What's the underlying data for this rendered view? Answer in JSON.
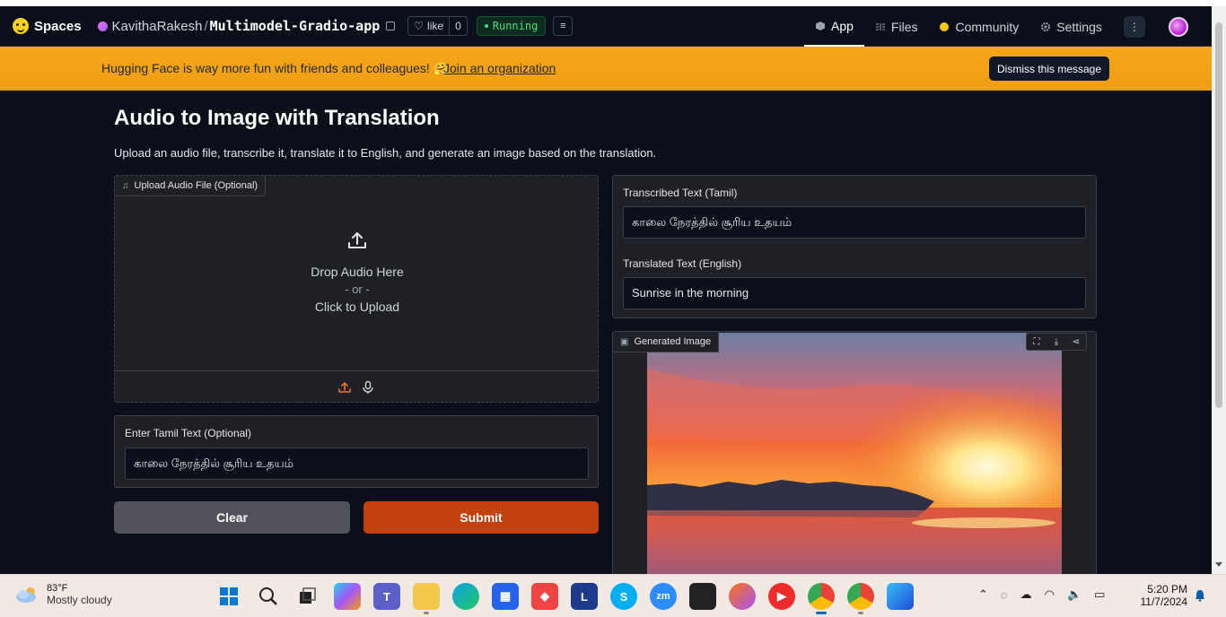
{
  "header": {
    "brand": "Spaces",
    "owner": "KavithaRakesh",
    "separator": "/",
    "repo": "Multimodel-Gradio-app",
    "like_label": "like",
    "like_count": "0",
    "status": "Running",
    "nav": [
      {
        "label": "App",
        "icon": "cube-icon",
        "active": true
      },
      {
        "label": "Files",
        "icon": "files-icon"
      },
      {
        "label": "Community",
        "icon": "community-icon"
      },
      {
        "label": "Settings",
        "icon": "gear-icon"
      }
    ]
  },
  "banner": {
    "text": "Hugging Face is way more fun with friends and colleagues! 🤗",
    "link": "Join an organization",
    "dismiss": "Dismiss this message"
  },
  "app": {
    "title": "Audio to Image with Translation",
    "description": "Upload an audio file, transcribe it, translate it to English, and generate an image based on the translation.",
    "upload": {
      "label": "Upload Audio File (Optional)",
      "drop": "Drop Audio Here",
      "or": "- or -",
      "click": "Click to Upload"
    },
    "tamil_input": {
      "label": "Enter Tamil Text (Optional)",
      "value": "காலை நேரத்தில் சூரிய உதயம்"
    },
    "clear": "Clear",
    "submit": "Submit",
    "transcribed": {
      "label": "Transcribed Text (Tamil)",
      "value": "காலை நேரத்தில் சூரிய உதயம்"
    },
    "translated": {
      "label": "Translated Text (English)",
      "value": "Sunrise in the morning"
    },
    "image_label": "Generated Image"
  },
  "taskbar": {
    "weather_temp": "83°F",
    "weather_desc": "Mostly cloudy",
    "time": "5:20 PM",
    "date": "11/7/2024",
    "apps": [
      "start",
      "search",
      "task-view",
      "copilot",
      "teams",
      "file-explorer",
      "edge",
      "store",
      "anydesk",
      "l-app",
      "skype",
      "zoom",
      "sticky-notes",
      "firefox",
      "youtube-music",
      "chrome-k",
      "chrome-r",
      "photos"
    ]
  },
  "colors": {
    "banner": "#f6a619",
    "submit": "#c2410c",
    "clear": "#52525b",
    "running": "#4ade80"
  }
}
